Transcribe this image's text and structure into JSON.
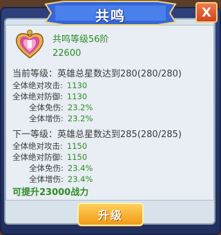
{
  "window": {
    "title": "共鸣",
    "close_label": "X"
  },
  "header": {
    "resonance_level": "共鸣等级56阶",
    "score": "22600"
  },
  "current": {
    "title": "当前等级：英雄总星数达到280(280/280)",
    "stats": [
      {
        "label": "全体绝对攻击:",
        "value": "1130"
      },
      {
        "label": "全体绝对防御:",
        "value": "1130"
      },
      {
        "label": "全体免伤:",
        "value": "23.2%"
      },
      {
        "label": "全体增伤:",
        "value": "23.2%"
      }
    ]
  },
  "next": {
    "title": "下一等级：英雄总星数达到285(280/285)",
    "stats": [
      {
        "label": "全体绝对攻击:",
        "value": "1150"
      },
      {
        "label": "全体绝对防御:",
        "value": "1150"
      },
      {
        "label": "全体免伤:",
        "value": "23.4%"
      },
      {
        "label": "全体增伤:",
        "value": "23.4%"
      }
    ]
  },
  "footer": {
    "power_gain": "可提升23000战力"
  },
  "actions": {
    "upgrade_label": "升级"
  },
  "colors": {
    "green_text": "#2f8b28",
    "frame_blue": "#2f3f7a",
    "button_orange": "#f19a17"
  },
  "icons": {
    "emblem": "heart-crest-icon"
  }
}
